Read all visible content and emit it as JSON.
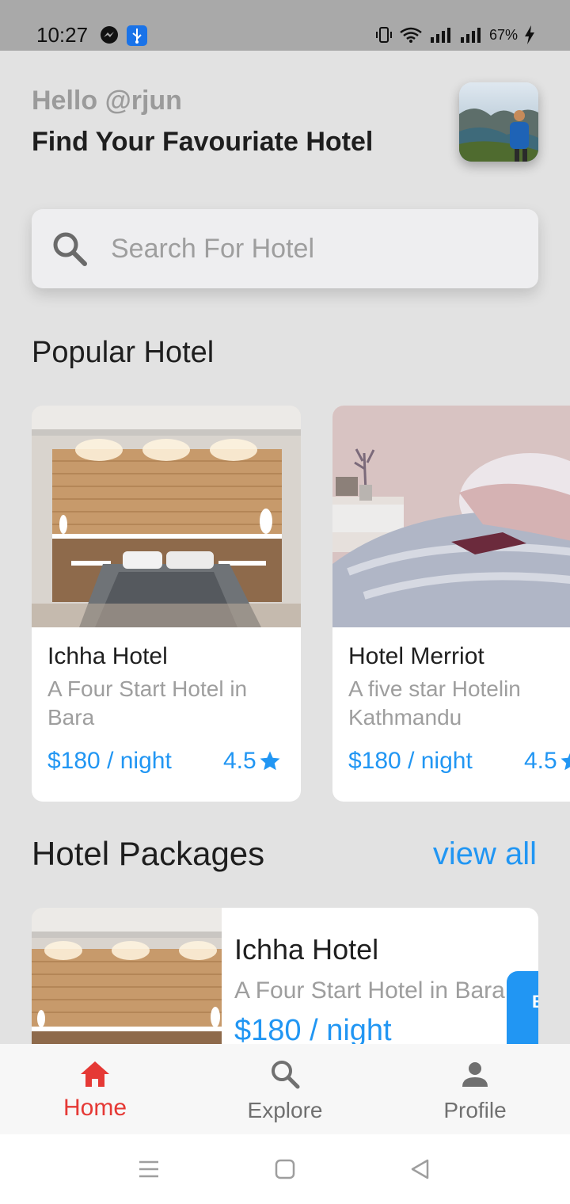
{
  "status_bar": {
    "time": "10:27",
    "battery": "67%"
  },
  "header": {
    "greeting": "Hello @rjun",
    "headline": "Find Your Favouriate Hotel"
  },
  "search": {
    "placeholder": "Search For Hotel",
    "value": ""
  },
  "popular": {
    "title": "Popular Hotel",
    "hotels": [
      {
        "name": "Ichha Hotel",
        "description": "A Four Start Hotel in Bara",
        "price": "$180 / night",
        "rating": "4.5"
      },
      {
        "name": "Hotel Merriot",
        "description": "A five star Hotelin Kathmandu",
        "price": "$180 / night",
        "rating": "4.5"
      }
    ]
  },
  "packages": {
    "title": "Hotel Packages",
    "view_all": "view all",
    "items": [
      {
        "name": "Ichha Hotel",
        "description": "A Four Start Hotel in Bara",
        "price": "$180 / night",
        "book_label": "Book"
      }
    ]
  },
  "bottom_nav": {
    "items": [
      {
        "label": "Home",
        "icon": "home-icon",
        "active": true
      },
      {
        "label": "Explore",
        "icon": "search-icon",
        "active": false
      },
      {
        "label": "Profile",
        "icon": "person-icon",
        "active": false
      }
    ]
  },
  "colors": {
    "accent": "#2196f3",
    "active_nav": "#e53935",
    "background": "#e2e2e2",
    "card": "#ffffff",
    "muted_text": "#9e9e9e"
  }
}
